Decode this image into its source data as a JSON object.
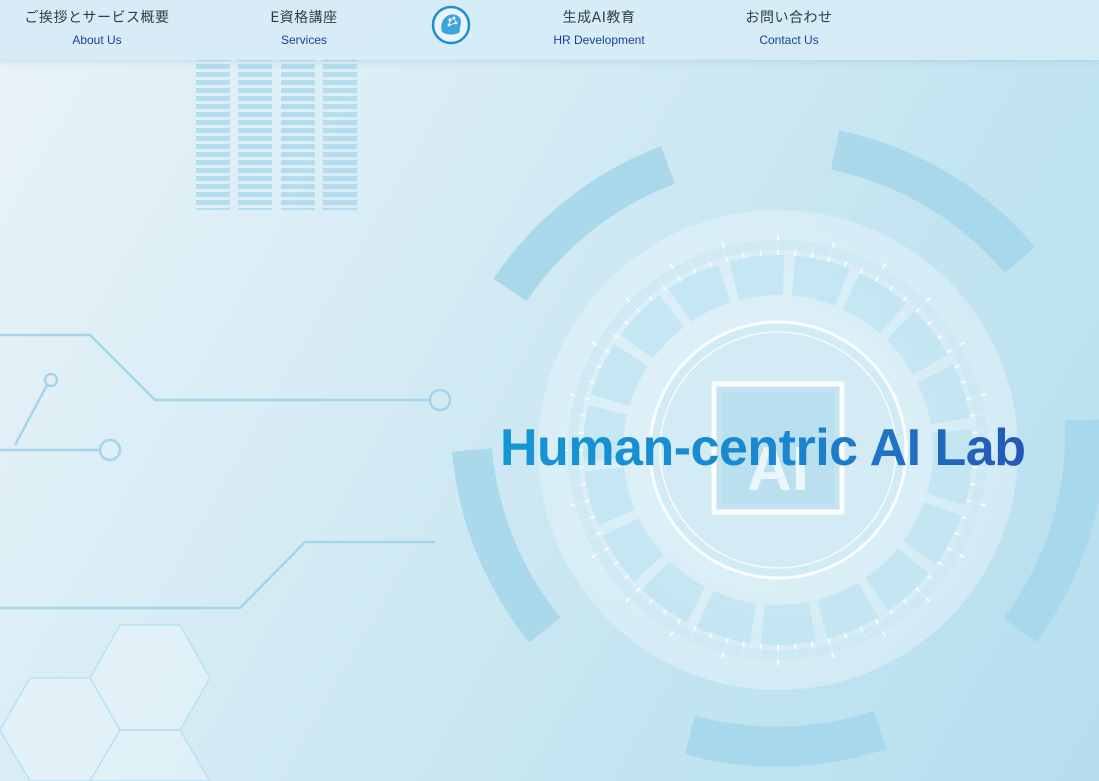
{
  "nav": {
    "items": [
      {
        "jp": "ご挨拶とサービス概要",
        "en": "About Us"
      },
      {
        "jp": "E資格講座",
        "en": "Services"
      },
      {
        "jp": "生成AI教育",
        "en": "HR Development"
      },
      {
        "jp": "お問い合わせ",
        "en": "Contact Us"
      }
    ],
    "logo_icon": "brain-head-logo-icon"
  },
  "hero": {
    "title": "Human-centric AI Lab",
    "chip_text": "AI"
  },
  "colors": {
    "accent": "#1496d6",
    "accent_dark": "#2457b5",
    "nav_link": "#1e3f9c",
    "nav_bg": "#d6ecf6"
  }
}
